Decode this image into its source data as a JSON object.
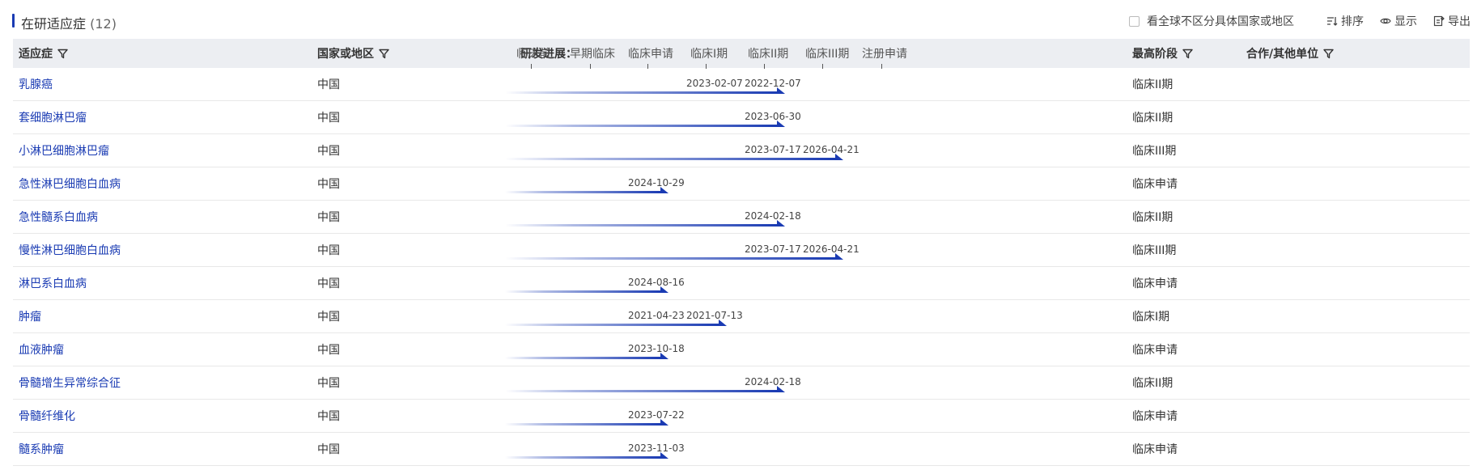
{
  "header": {
    "title": "在研适应症",
    "count": "(12)",
    "global_checkbox_label": "看全球不区分具体国家或地区",
    "sort_label": "排序",
    "display_label": "显示",
    "export_label": "导出"
  },
  "columns": {
    "indication": "适应症",
    "region": "国家或地区",
    "progress": "研发进展：",
    "highest_phase": "最高阶段",
    "partner": "合作/其他单位"
  },
  "stages": [
    "临床前",
    "早期临床",
    "临床申请",
    "临床I期",
    "临床II期",
    "临床III期",
    "注册申请"
  ],
  "colors": {
    "accent": "#1a3bb3",
    "header_bg": "#eceef2"
  },
  "rows": [
    {
      "indication": "乳腺癌",
      "region": "中国",
      "dates": [
        "2023-02-07",
        "2022-12-07"
      ],
      "date_stages": [
        3,
        4
      ],
      "bar_stage": 4,
      "phase": "临床II期",
      "partner": ""
    },
    {
      "indication": "套细胞淋巴瘤",
      "region": "中国",
      "dates": [
        "2023-06-30"
      ],
      "date_stages": [
        4
      ],
      "bar_stage": 4,
      "phase": "临床II期",
      "partner": ""
    },
    {
      "indication": "小淋巴细胞淋巴瘤",
      "region": "中国",
      "dates": [
        "2023-07-17",
        "2026-04-21"
      ],
      "date_stages": [
        4,
        5
      ],
      "bar_stage": 5,
      "phase": "临床III期",
      "partner": ""
    },
    {
      "indication": "急性淋巴细胞白血病",
      "region": "中国",
      "dates": [
        "2024-10-29"
      ],
      "date_stages": [
        2
      ],
      "bar_stage": 2,
      "phase": "临床申请",
      "partner": ""
    },
    {
      "indication": "急性髓系白血病",
      "region": "中国",
      "dates": [
        "2024-02-18"
      ],
      "date_stages": [
        4
      ],
      "bar_stage": 4,
      "phase": "临床II期",
      "partner": ""
    },
    {
      "indication": "慢性淋巴细胞白血病",
      "region": "中国",
      "dates": [
        "2023-07-17",
        "2026-04-21"
      ],
      "date_stages": [
        4,
        5
      ],
      "bar_stage": 5,
      "phase": "临床III期",
      "partner": ""
    },
    {
      "indication": "淋巴系白血病",
      "region": "中国",
      "dates": [
        "2024-08-16"
      ],
      "date_stages": [
        2
      ],
      "bar_stage": 2,
      "phase": "临床申请",
      "partner": ""
    },
    {
      "indication": "肿瘤",
      "region": "中国",
      "dates": [
        "2021-04-23",
        "2021-07-13"
      ],
      "date_stages": [
        2,
        3
      ],
      "bar_stage": 3,
      "phase": "临床I期",
      "partner": ""
    },
    {
      "indication": "血液肿瘤",
      "region": "中国",
      "dates": [
        "2023-10-18"
      ],
      "date_stages": [
        2
      ],
      "bar_stage": 2,
      "phase": "临床申请",
      "partner": ""
    },
    {
      "indication": "骨髓增生异常综合征",
      "region": "中国",
      "dates": [
        "2024-02-18"
      ],
      "date_stages": [
        4
      ],
      "bar_stage": 4,
      "phase": "临床II期",
      "partner": ""
    },
    {
      "indication": "骨髓纤维化",
      "region": "中国",
      "dates": [
        "2023-07-22"
      ],
      "date_stages": [
        2
      ],
      "bar_stage": 2,
      "phase": "临床申请",
      "partner": ""
    },
    {
      "indication": "髓系肿瘤",
      "region": "中国",
      "dates": [
        "2023-11-03"
      ],
      "date_stages": [
        2
      ],
      "bar_stage": 2,
      "phase": "临床申请",
      "partner": ""
    }
  ]
}
